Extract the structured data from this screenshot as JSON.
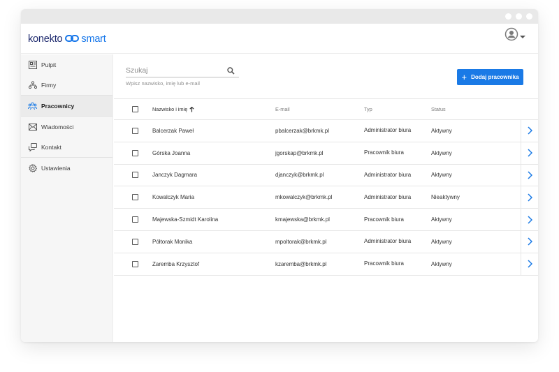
{
  "app": {
    "logo_part1": "konekto",
    "logo_part2": "smart",
    "brand_color": "#1a7ae6",
    "logo_dark": "#1e2a6e"
  },
  "sidebar": {
    "items": [
      {
        "label": "Pulpit",
        "icon": "dashboard-icon",
        "active": false
      },
      {
        "label": "Firmy",
        "icon": "companies-icon",
        "active": false
      },
      {
        "label": "Pracownicy",
        "icon": "employees-icon",
        "active": true
      },
      {
        "label": "Wiadomości",
        "icon": "messages-icon",
        "active": false
      },
      {
        "label": "Kontakt",
        "icon": "contact-icon",
        "active": false
      },
      {
        "label": "Ustawienia",
        "icon": "settings-icon",
        "active": false
      }
    ]
  },
  "search": {
    "placeholder": "Szukaj",
    "value": "",
    "hint": "Wpisz nazwisko, imię lub e-mail"
  },
  "toolbar": {
    "add_label": "Dodaj pracownika"
  },
  "table": {
    "columns": {
      "name": "Nazwisko i imię",
      "email": "E-mail",
      "type": "Typ",
      "status": "Status"
    },
    "rows": [
      {
        "name": "Balcerzak Paweł",
        "email": "pbalcerzak@brkmk.pl",
        "type": "Administrator biura",
        "status": "Aktywny"
      },
      {
        "name": "Górska Joanna",
        "email": "jgorskap@brkmk.pl",
        "type": "Pracownik biura",
        "status": "Aktywny"
      },
      {
        "name": "Janczyk Dagmara",
        "email": "djanczyk@brkmk.pl",
        "type": "Administrator biura",
        "status": "Aktywny"
      },
      {
        "name": "Kowalczyk Maria",
        "email": "mkowalczyk@brkmk.pl",
        "type": "Administrator biura",
        "status": "Nieaktywny"
      },
      {
        "name": "Majewska-Szmidt Karolina",
        "email": "kmajewska@brkmk.pl",
        "type": "Pracownik biura",
        "status": "Aktywny"
      },
      {
        "name": "Półtorak Monika",
        "email": "mpoltorak@brkmk.pl",
        "type": "Administrator biura",
        "status": "Aktywny"
      },
      {
        "name": "Zaremba Krzysztof",
        "email": "kzaremba@brkmk.pl",
        "type": "Pracownik biura",
        "status": "Aktywny"
      }
    ]
  }
}
